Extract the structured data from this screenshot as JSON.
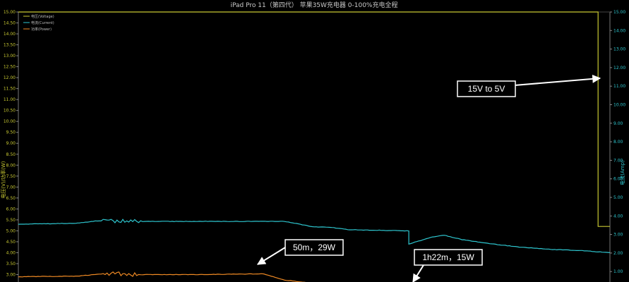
{
  "chart_data": {
    "type": "line",
    "title": "iPad Pro 11（第四代） 苹果35W充电器 0-100%充电全程",
    "ylabel_left": "电压(V)/功率(W)",
    "ylabel_right": "电流(Amp)",
    "ylim_left": [
      2.5,
      15.0
    ],
    "left_ticks": [
      "3.00",
      "3.50",
      "4.00",
      "4.50",
      "5.00",
      "5.50",
      "6.00",
      "6.50",
      "7.00",
      "7.50",
      "8.00",
      "8.50",
      "9.00",
      "9.50",
      "10.00",
      "10.50",
      "11.00",
      "11.50",
      "12.00",
      "12.50",
      "13.00",
      "13.50",
      "14.00",
      "14.50",
      "15.00"
    ],
    "right_ticks": [
      "1.00",
      "2.00",
      "3.00",
      "4.00",
      "5.00",
      "6.00",
      "7.00",
      "8.00",
      "9.00",
      "10.00",
      "11.00",
      "12.00",
      "13.00",
      "14.00",
      "15.00"
    ],
    "grid": false,
    "legend_position": "top-left",
    "series": [
      {
        "name": "电压(Voltage)",
        "color": "#c8c832",
        "x": [
          0.0,
          0.98,
          0.98,
          1.0
        ],
        "y": [
          15.0,
          15.0,
          5.2,
          5.2
        ]
      },
      {
        "name": "电流(Current)",
        "color": "#2ec6cf",
        "x": [
          0.0,
          0.1,
          0.13,
          0.2,
          0.3,
          0.4,
          0.45,
          0.5,
          0.53,
          0.56,
          0.6,
          0.66,
          0.66,
          0.7,
          0.72,
          0.75,
          0.8,
          0.85,
          0.9,
          0.95,
          1.0
        ],
        "y": [
          5.3,
          5.35,
          5.45,
          5.43,
          5.43,
          5.43,
          5.43,
          5.18,
          5.15,
          5.05,
          5.03,
          5.0,
          4.4,
          4.72,
          4.8,
          4.6,
          4.4,
          4.25,
          4.15,
          4.1,
          4.0
        ]
      },
      {
        "name": "功率(Power)",
        "color": "#f08a24",
        "x": [
          0.0,
          0.1,
          0.15,
          0.2,
          0.3,
          0.4,
          0.415,
          0.45,
          0.5,
          0.53,
          0.56
        ],
        "y": [
          2.9,
          2.93,
          3.05,
          3.0,
          3.0,
          3.03,
          3.03,
          2.75,
          2.6,
          2.55,
          2.5
        ]
      }
    ],
    "annotations": [
      {
        "text": "15V to 5V"
      },
      {
        "text": "50m，29W"
      },
      {
        "text": "1h22m，15W"
      }
    ]
  }
}
